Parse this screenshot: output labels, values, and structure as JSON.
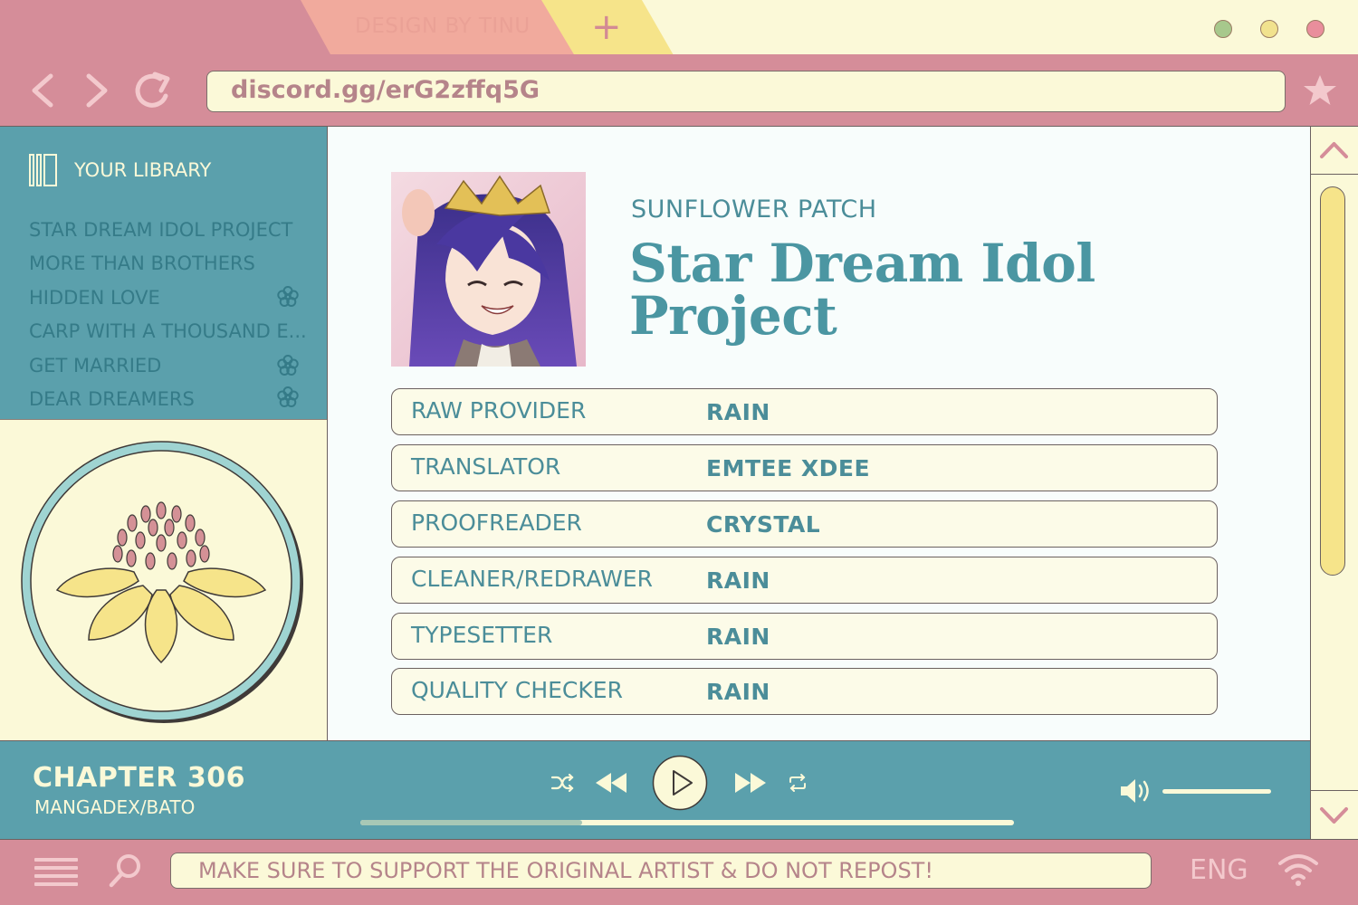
{
  "browser": {
    "tab_active_label": "DESIGN BY TINU",
    "new_tab_label": "+",
    "window_dots": [
      {
        "name": "minimize",
        "color": "#a7c88c"
      },
      {
        "name": "maximize",
        "color": "#f1e28e"
      },
      {
        "name": "close",
        "color": "#e98e9c"
      }
    ],
    "url": "discord.gg/erG2zffq5G",
    "icons": [
      "back-icon",
      "forward-icon",
      "reload-icon",
      "star-icon"
    ]
  },
  "sidebar": {
    "title": "YOUR LIBRARY",
    "items": [
      {
        "label": "STAR DREAM IDOL PROJECT",
        "flower": false
      },
      {
        "label": "MORE THAN BROTHERS",
        "flower": false
      },
      {
        "label": "HIDDEN LOVE",
        "flower": true
      },
      {
        "label": "CARP WITH A THOUSAND E...",
        "flower": false
      },
      {
        "label": "GET MARRIED",
        "flower": true
      },
      {
        "label": "DEAR DREAMERS",
        "flower": true
      }
    ]
  },
  "main": {
    "group": "SUNFLOWER PATCH",
    "title_line1": "Star Dream Idol",
    "title_line2": "Project",
    "credits": [
      {
        "role": "RAW PROVIDER",
        "name": "RAIN"
      },
      {
        "role": "TRANSLATOR",
        "name": "EMTEE XDEE"
      },
      {
        "role": "PROOFREADER",
        "name": "CRYSTAL"
      },
      {
        "role": "CLEANER/REDRAWER",
        "name": "RAIN"
      },
      {
        "role": "TYPESETTER",
        "name": "RAIN"
      },
      {
        "role": "QUALITY CHECKER",
        "name": "RAIN"
      }
    ]
  },
  "player": {
    "chapter": "CHAPTER 306",
    "source": "MANGADEX/BATO",
    "progress": 0.34,
    "volume": 1.0,
    "icons": [
      "shuffle-icon",
      "rewind-icon",
      "play-icon",
      "fast-forward-icon",
      "repeat-icon",
      "volume-icon"
    ]
  },
  "footer": {
    "notice": "MAKE SURE TO SUPPORT THE ORIGINAL ARTIST & DO NOT REPOST!",
    "language": "ENG",
    "icons": [
      "menu-icon",
      "search-icon",
      "wifi-icon"
    ]
  },
  "colors": {
    "pink": "#d58d99",
    "cream": "#fbf9d8",
    "teal": "#5ba0ac",
    "teal_text": "#4b8d99",
    "yellow": "#f6e48a"
  }
}
